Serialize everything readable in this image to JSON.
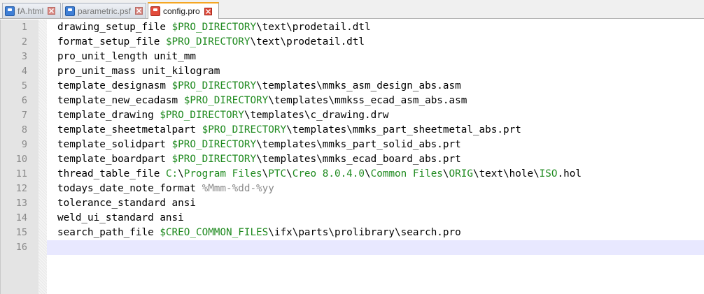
{
  "colors": {
    "active_tab_accent": "#f5a623",
    "current_line_highlight": "#e8e8ff",
    "variable_text": "#1f8a1f",
    "format_text": "#8a8a8a"
  },
  "tabs": [
    {
      "label": "fA.html",
      "icon": "save-disk-icon",
      "active": false
    },
    {
      "label": "parametric.psf",
      "icon": "save-disk-icon",
      "active": false
    },
    {
      "label": "config.pro",
      "icon": "unsaved-disk-icon",
      "active": true
    }
  ],
  "editor": {
    "current_line": 16,
    "lines": [
      {
        "num": "1",
        "tokens": [
          [
            "t",
            "drawing_setup_file "
          ],
          [
            "v",
            "$PRO_DIRECTORY"
          ],
          [
            "s",
            "\\"
          ],
          [
            "t",
            "text"
          ],
          [
            "s",
            "\\"
          ],
          [
            "t",
            "prodetail.dtl"
          ]
        ]
      },
      {
        "num": "2",
        "tokens": [
          [
            "t",
            "format_setup_file "
          ],
          [
            "v",
            "$PRO_DIRECTORY"
          ],
          [
            "s",
            "\\"
          ],
          [
            "t",
            "text"
          ],
          [
            "s",
            "\\"
          ],
          [
            "t",
            "prodetail.dtl"
          ]
        ]
      },
      {
        "num": "3",
        "tokens": [
          [
            "t",
            "pro_unit_length unit_mm"
          ]
        ]
      },
      {
        "num": "4",
        "tokens": [
          [
            "t",
            "pro_unit_mass unit_kilogram"
          ]
        ]
      },
      {
        "num": "5",
        "tokens": [
          [
            "t",
            "template_designasm "
          ],
          [
            "v",
            "$PRO_DIRECTORY"
          ],
          [
            "s",
            "\\"
          ],
          [
            "t",
            "templates"
          ],
          [
            "s",
            "\\"
          ],
          [
            "t",
            "mmks_asm_design_abs.asm"
          ]
        ]
      },
      {
        "num": "6",
        "tokens": [
          [
            "t",
            "template_new_ecadasm "
          ],
          [
            "v",
            "$PRO_DIRECTORY"
          ],
          [
            "s",
            "\\"
          ],
          [
            "t",
            "templates"
          ],
          [
            "s",
            "\\"
          ],
          [
            "t",
            "mmkss_ecad_asm_abs.asm"
          ]
        ]
      },
      {
        "num": "7",
        "tokens": [
          [
            "t",
            "template_drawing "
          ],
          [
            "v",
            "$PRO_DIRECTORY"
          ],
          [
            "s",
            "\\"
          ],
          [
            "t",
            "templates"
          ],
          [
            "s",
            "\\"
          ],
          [
            "t",
            "c_drawing.drw"
          ]
        ]
      },
      {
        "num": "8",
        "tokens": [
          [
            "t",
            "template_sheetmetalpart "
          ],
          [
            "v",
            "$PRO_DIRECTORY"
          ],
          [
            "s",
            "\\"
          ],
          [
            "t",
            "templates"
          ],
          [
            "s",
            "\\"
          ],
          [
            "t",
            "mmks_part_sheetmetal_abs.prt"
          ]
        ]
      },
      {
        "num": "9",
        "tokens": [
          [
            "t",
            "template_solidpart "
          ],
          [
            "v",
            "$PRO_DIRECTORY"
          ],
          [
            "s",
            "\\"
          ],
          [
            "t",
            "templates"
          ],
          [
            "s",
            "\\"
          ],
          [
            "t",
            "mmks_part_solid_abs.prt"
          ]
        ]
      },
      {
        "num": "10",
        "tokens": [
          [
            "t",
            "template_boardpart "
          ],
          [
            "v",
            "$PRO_DIRECTORY"
          ],
          [
            "s",
            "\\"
          ],
          [
            "t",
            "templates"
          ],
          [
            "s",
            "\\"
          ],
          [
            "t",
            "mmks_ecad_board_abs.prt"
          ]
        ]
      },
      {
        "num": "11",
        "tokens": [
          [
            "t",
            "thread_table_file "
          ],
          [
            "v",
            "C:"
          ],
          [
            "s",
            "\\"
          ],
          [
            "v",
            "Program Files"
          ],
          [
            "s",
            "\\"
          ],
          [
            "v",
            "PTC"
          ],
          [
            "s",
            "\\"
          ],
          [
            "v",
            "Creo 8.0.4.0"
          ],
          [
            "s",
            "\\"
          ],
          [
            "v",
            "Common Files"
          ],
          [
            "s",
            "\\"
          ],
          [
            "v",
            "ORIG"
          ],
          [
            "s",
            "\\"
          ],
          [
            "t",
            "text"
          ],
          [
            "s",
            "\\"
          ],
          [
            "t",
            "hole"
          ],
          [
            "s",
            "\\"
          ],
          [
            "v",
            "ISO"
          ],
          [
            "t",
            ".hol"
          ]
        ]
      },
      {
        "num": "12",
        "tokens": [
          [
            "t",
            "todays_date_note_format "
          ],
          [
            "f",
            "%Mmm-%dd-%yy"
          ]
        ]
      },
      {
        "num": "13",
        "tokens": [
          [
            "t",
            "tolerance_standard ansi"
          ]
        ]
      },
      {
        "num": "14",
        "tokens": [
          [
            "t",
            "weld_ui_standard ansi"
          ]
        ]
      },
      {
        "num": "15",
        "tokens": [
          [
            "t",
            "search_path_file "
          ],
          [
            "v",
            "$CREO_COMMON_FILES"
          ],
          [
            "s",
            "\\"
          ],
          [
            "t",
            "ifx"
          ],
          [
            "s",
            "\\"
          ],
          [
            "t",
            "parts"
          ],
          [
            "s",
            "\\"
          ],
          [
            "t",
            "prolibrary"
          ],
          [
            "s",
            "\\"
          ],
          [
            "t",
            "search.pro"
          ]
        ]
      },
      {
        "num": "16",
        "tokens": []
      }
    ]
  }
}
